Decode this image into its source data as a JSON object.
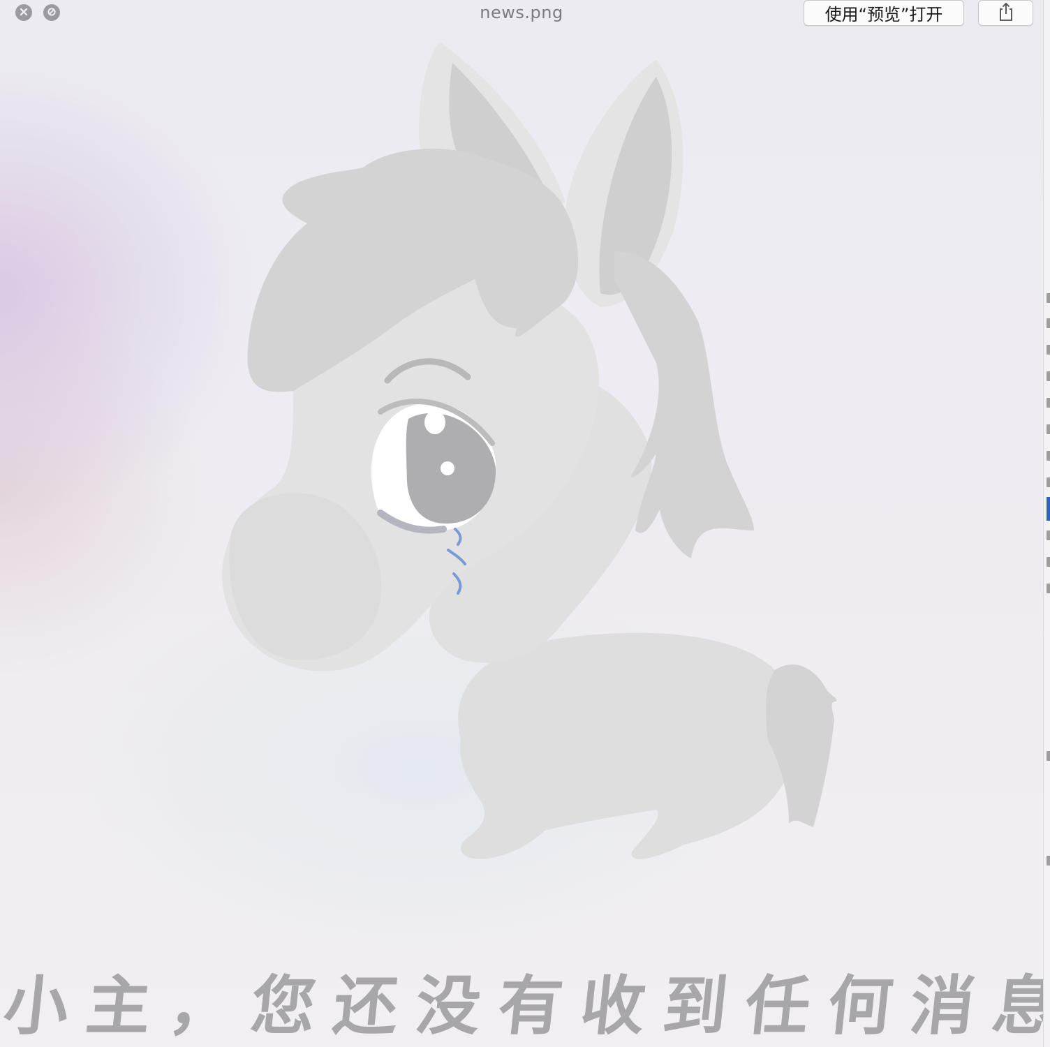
{
  "window": {
    "title": "news.png",
    "open_with_preview_label": "使用“预览”打开"
  },
  "controls": {
    "close_icon": "close-icon",
    "fullscreen_icon": "fullscreen-disabled-icon",
    "share_icon": "share-icon"
  },
  "image": {
    "illustration": "crying-donkey-illustration",
    "message": "小主，您还没有收到任何消息"
  },
  "colors": {
    "illustration_gray": "#dcdcdc",
    "tear_blue": "#7a9ad6",
    "message_gray": "#a7a7a9"
  }
}
